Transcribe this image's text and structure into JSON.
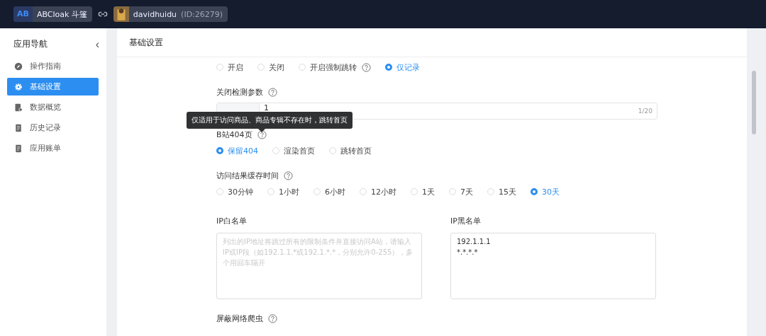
{
  "topbar": {
    "logo": "AB",
    "app_name": "ABCloak 斗篷",
    "user": "davidhuidu",
    "user_id": "(ID:26279)"
  },
  "sidebar": {
    "title": "应用导航",
    "collapse": "‹",
    "items": [
      {
        "label": "操作指南",
        "selected": false
      },
      {
        "label": "基础设置",
        "selected": true
      },
      {
        "label": "数据概览",
        "selected": false
      },
      {
        "label": "历史记录",
        "selected": false
      },
      {
        "label": "应用账单",
        "selected": false
      }
    ]
  },
  "page_title": "基础设置",
  "mode_options": [
    {
      "label": "开启",
      "selected": false,
      "help": false
    },
    {
      "label": "关闭",
      "selected": false,
      "help": false
    },
    {
      "label": "开启强制跳转",
      "selected": false,
      "help": true
    },
    {
      "label": "仅记录",
      "selected": true,
      "help": false
    }
  ],
  "param": {
    "label": "关闭检测参数",
    "value": "1",
    "count": "1/20"
  },
  "tooltip": "仅适用于访问商品、商品专辑不存在时，跳转首页",
  "page404": {
    "label": "B站404页",
    "options": [
      {
        "label": "保留404",
        "selected": true
      },
      {
        "label": "渲染首页",
        "selected": false
      },
      {
        "label": "跳转首页",
        "selected": false
      }
    ]
  },
  "cache": {
    "label": "访问结果缓存时间",
    "options": [
      {
        "label": "30分钟",
        "selected": false
      },
      {
        "label": "1小时",
        "selected": false
      },
      {
        "label": "6小时",
        "selected": false
      },
      {
        "label": "12小时",
        "selected": false
      },
      {
        "label": "1天",
        "selected": false
      },
      {
        "label": "7天",
        "selected": false
      },
      {
        "label": "15天",
        "selected": false
      },
      {
        "label": "30天",
        "selected": true
      }
    ]
  },
  "whitelist": {
    "label": "IP白名单",
    "placeholder": "列出的IP地址将跳过所有的限制条件并直接访问A站，请输入IP或IP段（如192.1.1.*或192.1.*.*，分别允许0-255），多个用回车隔开"
  },
  "blacklist": {
    "label": "IP黑名单",
    "value": "192.1.1.1\n*.*.*.*"
  },
  "crawler": {
    "label": "屏蔽网络爬虫"
  }
}
